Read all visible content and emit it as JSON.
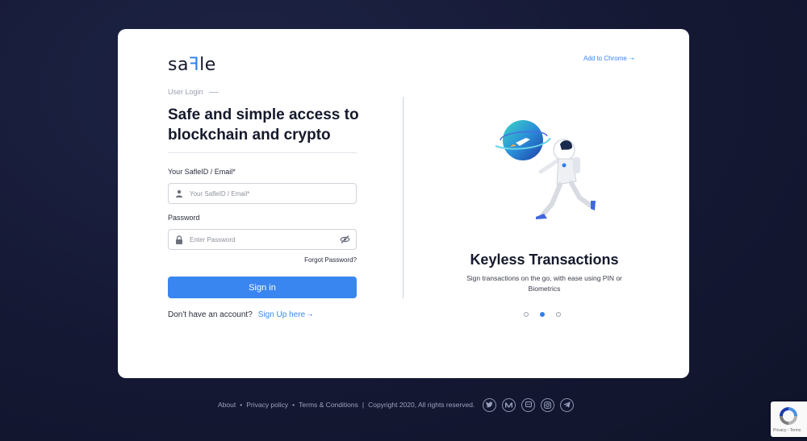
{
  "brand": {
    "logo_text_before": "sa",
    "logo_text_after": "le",
    "accent": "#3a86f1"
  },
  "login": {
    "tag": "User Login",
    "headline": "Safe and simple access to blockchain and crypto",
    "id_label": "Your SafleID / Email*",
    "id_placeholder": "Your SafleID / Email*",
    "id_value": "",
    "password_label": "Password",
    "password_placeholder": "Enter Password",
    "password_value": "",
    "forgot_label": "Forgot Password?",
    "signin_label": "Sign in",
    "no_account_text": "Don't have an account?",
    "signup_label": "Sign Up here"
  },
  "promo": {
    "chrome_link": "Add to Chrome",
    "slide_title": "Keyless Transactions",
    "slide_desc": "Sign transactions on the go, with ease using PIN or Biometrics",
    "slides_total": 3,
    "active_slide": 2
  },
  "footer": {
    "about": "About",
    "privacy": "Privacy policy",
    "terms": "Terms & Conditions",
    "copyright": "Copyright 2020, All rights reserved.",
    "socials": [
      "twitter-icon",
      "medium-icon",
      "discord-icon",
      "instagram-icon",
      "telegram-icon"
    ]
  },
  "recaptcha": {
    "text": "Privacy - Terms"
  },
  "colors": {
    "background": "#151a33",
    "card": "#ffffff",
    "primary": "#3a86f1",
    "text": "#16192c"
  }
}
